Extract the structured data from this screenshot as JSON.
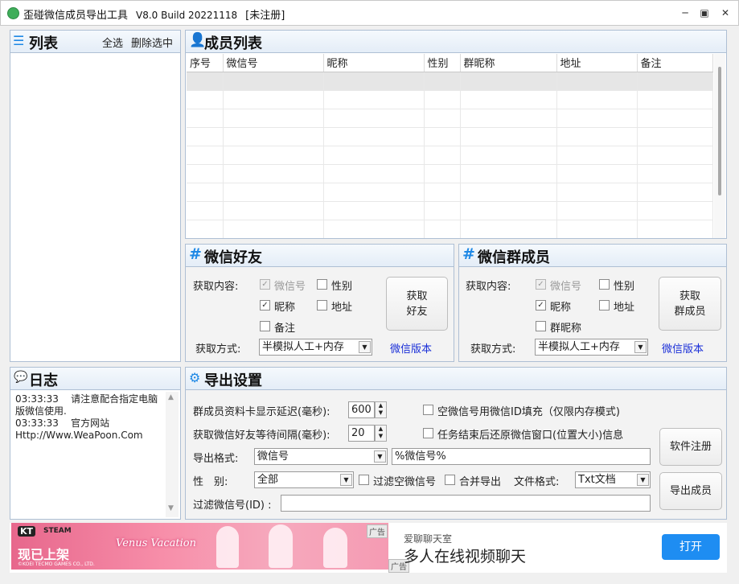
{
  "window": {
    "title": "歪碰微信成员导出工具",
    "version": "V8.0 Build 20221118",
    "status": "[未注册]"
  },
  "left_list": {
    "title": "列表",
    "select_all": "全选",
    "delete_selected": "删除选中"
  },
  "members": {
    "title": "成员列表",
    "columns": [
      "序号",
      "微信号",
      "昵称",
      "性别",
      "群昵称",
      "地址",
      "备注"
    ]
  },
  "friends": {
    "title": "微信好友",
    "content_label": "获取内容:",
    "options": [
      {
        "label": "微信号",
        "checked": true,
        "disabled": true
      },
      {
        "label": "性别",
        "checked": false,
        "disabled": false
      },
      {
        "label": "昵称",
        "checked": true,
        "disabled": false
      },
      {
        "label": "地址",
        "checked": false,
        "disabled": false
      },
      {
        "label": "备注",
        "checked": false,
        "disabled": false
      }
    ],
    "fetch_button": "获取\n好友",
    "method_label": "获取方式:",
    "method_value": "半模拟人工+内存",
    "version_link": "微信版本"
  },
  "groups": {
    "title": "微信群成员",
    "content_label": "获取内容:",
    "options": [
      {
        "label": "微信号",
        "checked": true,
        "disabled": true
      },
      {
        "label": "性别",
        "checked": false,
        "disabled": false
      },
      {
        "label": "昵称",
        "checked": true,
        "disabled": false
      },
      {
        "label": "地址",
        "checked": false,
        "disabled": false
      },
      {
        "label": "群昵称",
        "checked": false,
        "disabled": false
      }
    ],
    "fetch_button": "获取\n群成员",
    "method_label": "获取方式:",
    "method_value": "半模拟人工+内存",
    "version_link": "微信版本"
  },
  "log": {
    "title": "日志",
    "lines": [
      "03:33:33    请注意配合指定电脑",
      "版微信使用.",
      "03:33:33    官方网站",
      "Http://Www.WeaPoon.Com"
    ]
  },
  "export": {
    "title": "导出设置",
    "delay_label": "群成员资料卡显示延迟(毫秒):",
    "delay_value": "600",
    "interval_label": "获取微信好友等待间隔(毫秒):",
    "interval_value": "20",
    "fill_id_label": "空微信号用微信ID填充（仅限内存模式)",
    "restore_window_label": "任务结束后还原微信窗口(位置大小)信息",
    "format_label": "导出格式:",
    "format_value": "微信号",
    "format_template": "%微信号%",
    "gender_label": "性　别:",
    "gender_value": "全部",
    "filter_empty_label": "过滤空微信号",
    "merge_label": "合并导出",
    "file_format_label": "文件格式:",
    "file_format_value": "Txt文档",
    "filter_id_label": "过滤微信号(ID) :",
    "filter_id_value": "",
    "register_button": "软件注册",
    "export_button": "导出成员"
  },
  "ads": {
    "left_tag": "广告",
    "left_text1": "现已上架",
    "left_brand1": "KT",
    "left_brand2": "STEAM",
    "left_logo": "Venus Vacation",
    "left_copyright": "©KOEI TECMO GAMES CO., LTD.",
    "right_tag": "广告",
    "right_subtitle": "爱聊聊天室",
    "right_title": "多人在线视频聊天",
    "right_button": "打开"
  },
  "colors": {
    "accent": "#1e88e5",
    "link": "#1a2fd8",
    "ad_button": "#1e8df2"
  }
}
